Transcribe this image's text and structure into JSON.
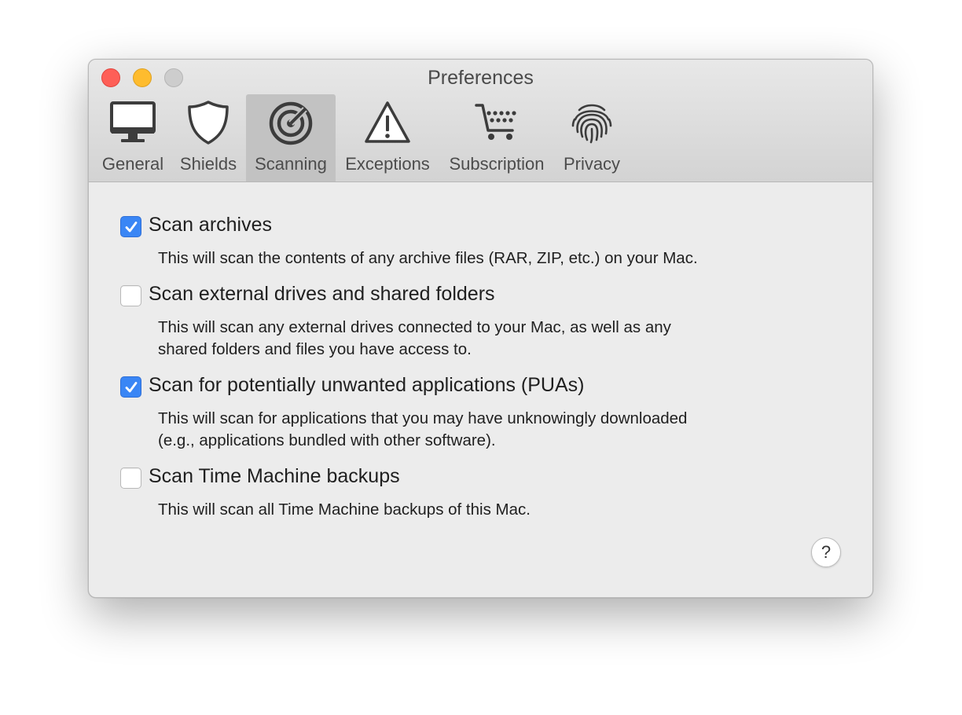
{
  "window": {
    "title": "Preferences"
  },
  "tabs": [
    {
      "label": "General",
      "icon": "monitor-icon",
      "selected": false
    },
    {
      "label": "Shields",
      "icon": "shield-icon",
      "selected": false
    },
    {
      "label": "Scanning",
      "icon": "target-icon",
      "selected": true
    },
    {
      "label": "Exceptions",
      "icon": "warning-icon",
      "selected": false
    },
    {
      "label": "Subscription",
      "icon": "cart-icon",
      "selected": false
    },
    {
      "label": "Privacy",
      "icon": "fingerprint-icon",
      "selected": false
    }
  ],
  "options": [
    {
      "label": "Scan archives",
      "checked": true,
      "description": [
        "This will scan the contents of any archive files (RAR, ZIP, etc.) on your Mac."
      ]
    },
    {
      "label": "Scan external drives and shared folders",
      "checked": false,
      "description": [
        "This will scan any external drives connected to your Mac, as well as any",
        "shared folders and files you have access to."
      ]
    },
    {
      "label": "Scan for potentially unwanted applications (PUAs)",
      "checked": true,
      "description": [
        "This will scan for applications that you may have unknowingly downloaded",
        "(e.g., applications bundled with other software)."
      ]
    },
    {
      "label": "Scan Time Machine backups",
      "checked": false,
      "description": [
        "This will scan all Time Machine backups of this Mac."
      ]
    }
  ],
  "help": {
    "label": "?"
  },
  "colors": {
    "accent": "#3a86f5",
    "close": "#fe5f57",
    "minimize": "#febc2e",
    "zoom_disabled": "#cdcdcd"
  }
}
